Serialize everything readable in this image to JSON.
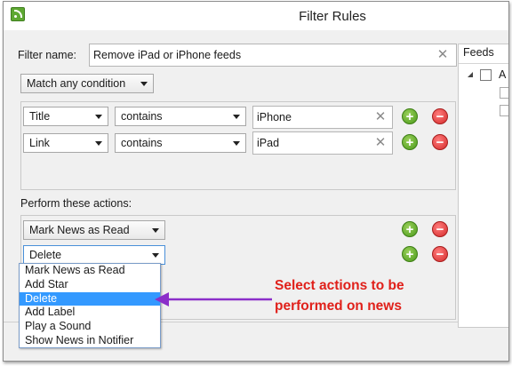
{
  "window": {
    "title": "Filter Rules",
    "app_icon": "rss-feed-icon"
  },
  "filter": {
    "name_label": "Filter name:",
    "name_value": "Remove iPad or iPhone feeds",
    "match_mode": "Match any condition"
  },
  "conditions": [
    {
      "field": "Title",
      "operator": "contains",
      "value": "iPhone"
    },
    {
      "field": "Link",
      "operator": "contains",
      "value": "iPad"
    }
  ],
  "actions": {
    "label": "Perform these actions:",
    "rows": [
      {
        "value": "Mark News as Read"
      },
      {
        "value": "Delete"
      }
    ],
    "dropdown_options": [
      "Mark News as Read",
      "Add Star",
      "Delete",
      "Add Label",
      "Play a Sound",
      "Show News in Notifier"
    ],
    "highlighted_option": "Delete"
  },
  "feeds": {
    "header": "Feeds",
    "first_item_prefix": "A"
  },
  "annotation": {
    "line1": "Select actions to be",
    "line2": "performed on news",
    "color": "#e0201a",
    "arrow_color": "#8b2fc9"
  },
  "colors": {
    "add_button": "#4a9a1a",
    "remove_button": "#d42a2a",
    "selection": "#3399ff"
  }
}
